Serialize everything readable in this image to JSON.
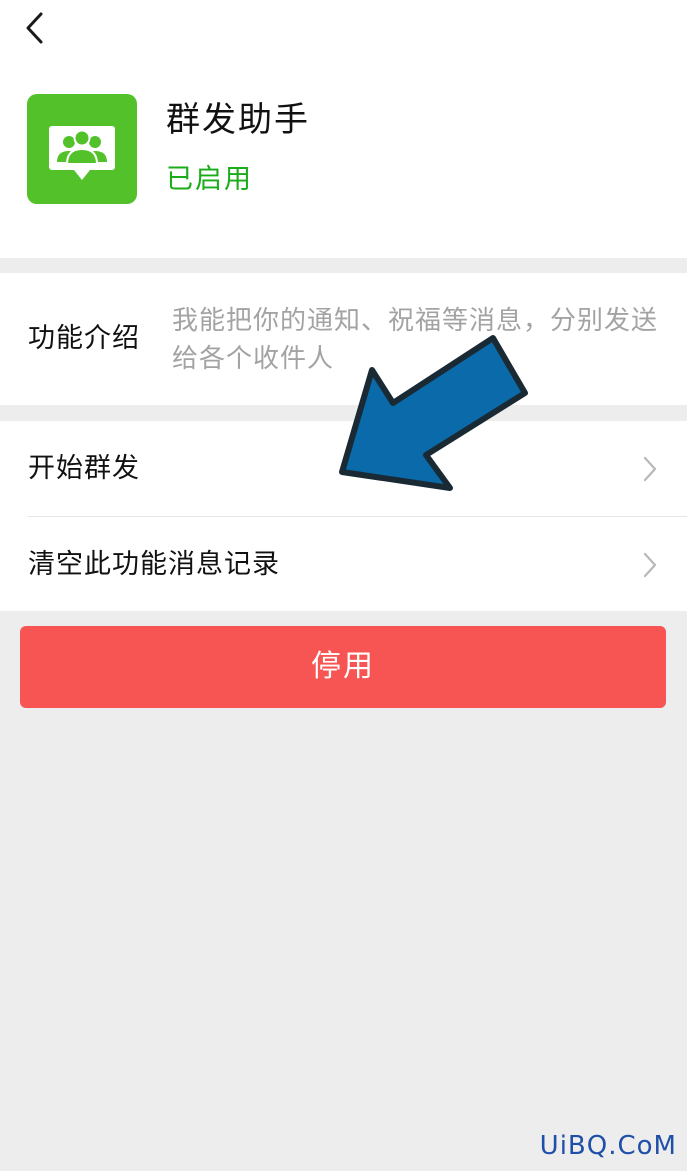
{
  "header": {
    "back_icon": "chevron-left-icon"
  },
  "app": {
    "icon": "group-chat-icon",
    "icon_color": "#53c22a",
    "name": "群发助手",
    "status": "已启用",
    "status_color": "#1aad19"
  },
  "intro": {
    "label": "功能介绍",
    "description": "我能把你的通知、祝福等消息，分别发送给各个收件人"
  },
  "actions": [
    {
      "label": "开始群发",
      "icon": "chevron-right-icon"
    },
    {
      "label": "清空此功能消息记录",
      "icon": "chevron-right-icon"
    }
  ],
  "disable_button": {
    "label": "停用",
    "color": "#f75554"
  },
  "annotation": {
    "icon": "pointing-arrow-icon",
    "color": "#0b6aa9"
  },
  "watermark": {
    "text": "UiBQ.CoM"
  }
}
